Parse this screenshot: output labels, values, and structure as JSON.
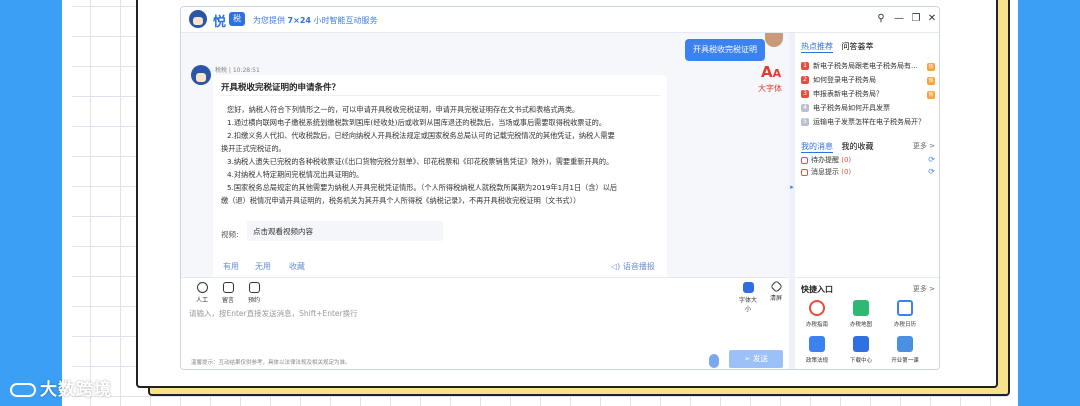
{
  "window": {
    "logo_text": "悦",
    "logo_badge": "税",
    "slogan_prefix": "为您提供",
    "slogan_highlight": "7×24",
    "slogan_suffix": "小时智能互动服务",
    "controls": [
      "user-icon",
      "minimize-icon",
      "restore-icon",
      "close-icon"
    ]
  },
  "chat": {
    "user_message": "开具税收完税证明",
    "font_size_label": "大字体",
    "bot_name_time": "税税 | 10:28:51",
    "answer_title": "开具税收完税证明的申请条件？",
    "answer_paragraphs": [
      "您好，纳税人符合下列情形之一的，可以申请开具税收完税证明，申请开具完税证明存在文书式和表格式两类。",
      "1.通过横向联网电子缴税系统划缴税款到国库(经收处)后或收到从国库退还的税款后，当场或事后需要取得税收票证的。",
      "2.扣缴义务人代扣、代收税款后，已经向纳税人开具税法规定或国家税务总局认可的记载完税情况的其他凭证，纳税人需要",
      "换开正式完税证的。",
      "3.纳税人遗失已完税的各种税收票证(《出口货物完税分割单》、印花税票和《印花税票销售凭证》除外)，需要重新开具的。",
      "4.对纳税人特定期间完税情况出具证明的。",
      "5.国家税务总局规定的其他需要为纳税人开具完税凭证情形。（个人所得税纳税人就税款所属期为2019年1月1日（含）以后",
      "缴（退）税情况申请开具证明的，税务机关为其开具个人所得税《纳税记录》，不再开具税收完税证明（文书式））"
    ],
    "video_label": "视频:",
    "video_link": "点击观看视频内容",
    "actions": [
      "有用",
      "无用",
      "收藏"
    ],
    "voice_label": "语音播报"
  },
  "input": {
    "tools": [
      "人工",
      "留言",
      "预约"
    ],
    "right_tools": [
      "字体大小",
      "清屏"
    ],
    "placeholder": "请输入，按Enter直接发送消息，Shift+Enter换行",
    "disclaimer": "温馨提示：互动结果仅供参考，具体以法律法规及相关规定为准。",
    "send_label": "➢ 发送"
  },
  "sidebar": {
    "tabs": [
      "热点推荐",
      "问答荟萃"
    ],
    "hot_items": [
      {
        "num": "1",
        "text": "新电子税务局跟老电子税务局有..."
      },
      {
        "num": "2",
        "text": "如何登录电子税务局"
      },
      {
        "num": "3",
        "text": "申报表新电子税务局？"
      },
      {
        "num": "4",
        "text": "电子税务局如何开具发票"
      },
      {
        "num": "5",
        "text": "运输电子发票怎样在电子税务局开？"
      }
    ],
    "msg_tabs": [
      "我的消息",
      "我的收藏"
    ],
    "more": "更多 >",
    "messages": [
      {
        "label": "待办提醒",
        "count": "(0)"
      },
      {
        "label": "消息提示",
        "count": "(0)"
      }
    ],
    "quick_title": "快捷入口",
    "quick_more": "更多 >",
    "quick_items": [
      "办税指南",
      "办税地图",
      "办税日历",
      "政策法规",
      "下载中心",
      "开业第一课"
    ]
  },
  "watermark": "大数跨境",
  "colors": {
    "accent": "#3b82f0",
    "frame_blue": "#3a9ff5",
    "card_yellow": "#f6e28a",
    "hot_red": "#e64d3d"
  }
}
